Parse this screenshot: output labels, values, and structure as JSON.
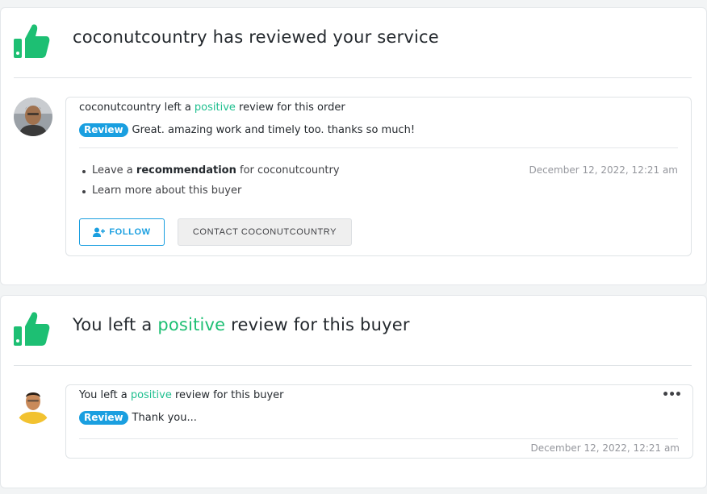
{
  "colors": {
    "accent": "#1dbf73",
    "badge": "#1a9fe0",
    "thumb": "#1dbf73"
  },
  "card1": {
    "heading": "coconutcountry has reviewed your service",
    "title_pre": "coconutcountry left a ",
    "title_accent": "positive",
    "title_post": " review for this order",
    "badge": "Review",
    "review_text": "Great. amazing work and timely too. thanks so much!",
    "bullet1_pre": "Leave a ",
    "bullet1_bold": "recommendation",
    "bullet1_post": " for coconutcountry",
    "bullet2": "Learn more about this buyer",
    "date": "December 12, 2022, 12:21 am",
    "follow_label": "FOLLOW",
    "contact_label": "CONTACT COCONUTCOUNTRY",
    "icon": "thumbs-up-icon"
  },
  "card2": {
    "heading_pre": "You left a ",
    "heading_accent": "positive",
    "heading_post": " review for this buyer",
    "title_pre": "You left a ",
    "title_accent": "positive",
    "title_post": " review for this buyer",
    "badge": "Review",
    "review_text": "Thank you...",
    "date": "December 12, 2022, 12:21 am",
    "more": "•••",
    "icon": "thumbs-up-icon"
  }
}
